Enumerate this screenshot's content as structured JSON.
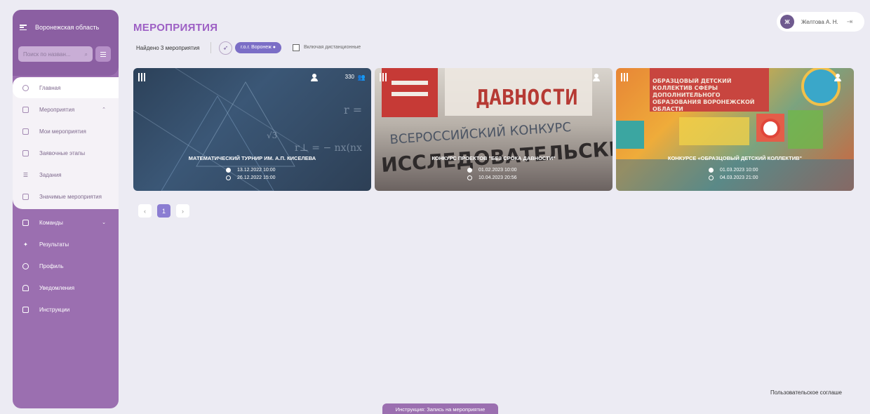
{
  "sidebar": {
    "region": "Воронежская область",
    "search_placeholder": "Поиск по назван...",
    "items": [
      {
        "label": "Главная"
      },
      {
        "label": "Мероприятия"
      },
      {
        "label": "Мои мероприятия"
      },
      {
        "label": "Заявочные этапы"
      },
      {
        "label": "Задания"
      },
      {
        "label": "Значимые мероприятия"
      },
      {
        "label": "Команды"
      },
      {
        "label": "Результаты"
      },
      {
        "label": "Профиль"
      },
      {
        "label": "Уведомления"
      },
      {
        "label": "Инструкции"
      }
    ]
  },
  "header": {
    "title": "МЕРОПРИЯТИЯ",
    "found": "Найдено 3 мероприятия",
    "location_chip": "г.о.г. Воронеж",
    "include_remote": "Включая дистанционные",
    "user_name": "Желтова А. Н.",
    "user_initials": "Ж"
  },
  "cards": [
    {
      "title": "МАТЕМАТИЧЕСКИЙ ТУРНИР ИМ. А.П. КИСЕЛЕВА",
      "start": "13.12.2022 10:00",
      "end": "26.12.2022 15:00",
      "count": "330"
    },
    {
      "title": "КОНКУРС ПРОЕКТОВ \"БЕЗ СРОКА ДАВНОСТИ\"",
      "start": "01.02.2023 10:00",
      "end": "10.04.2023 20:56",
      "bg_line1": "ДАВНОСТИ",
      "bg_line2": "ВСЕРОССИЙСКИЙ КОНКУРС",
      "bg_line3": "ИССЛЕДОВАТЕЛЬСКИХ"
    },
    {
      "title": "КОНКУРСЕ «ОБРАЗЦОВЫЙ ДЕТСКИЙ КОЛЛЕКТИВ\"",
      "start": "01.03.2023 10:00",
      "end": "04.03.2023 21:00",
      "bg_text": "ОБРАЗЦОВЫЙ ДЕТСКИЙ КОЛЛЕКТИВ СФЕРЫ ДОПОЛНИТЕЛЬНОГО ОБРАЗОВАНИЯ ВОРОНЕЖСКОЙ ОБЛАСТИ"
    }
  ],
  "pagination": {
    "prev": "‹",
    "current": "1",
    "next": "›"
  },
  "footer": {
    "agreement": "Пользовательское соглаше",
    "instruction_bar": "Инструкция: Запись на мероприятие"
  },
  "colors": {
    "accent": "#9b6fb0",
    "title": "#9d5fc4",
    "chip": "#7b6ec6"
  }
}
